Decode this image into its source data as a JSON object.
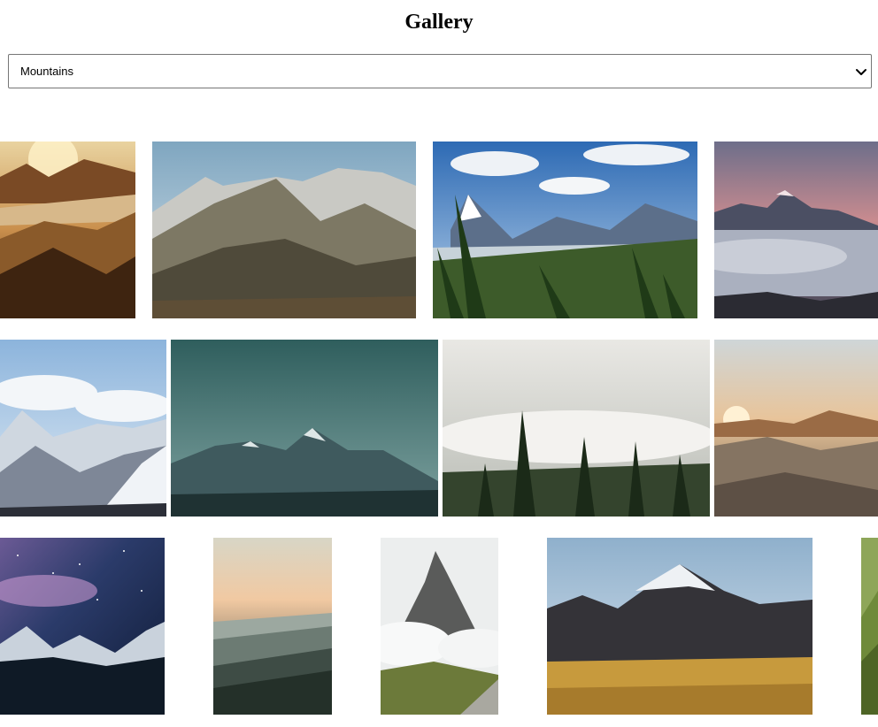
{
  "header": {
    "title": "Gallery"
  },
  "filter": {
    "selected": "Mountains",
    "icon": "chevron-down-icon"
  },
  "gallery": {
    "rows": [
      {
        "photos": [
          "desert-mountain-sunset",
          "rocky-alpine-peaks",
          "valley-with-pines",
          "peak-above-clouds"
        ]
      },
      {
        "photos": [
          "snowy-range-clouds",
          "teal-dusk-peaks",
          "misty-pine-forest",
          "desert-dunes-sunrise"
        ]
      },
      {
        "photos": [
          "milky-way-mountains",
          "hazy-layered-hills",
          "peak-in-clouds",
          "golden-meadow-peak",
          "green-slope-edge"
        ]
      }
    ]
  }
}
